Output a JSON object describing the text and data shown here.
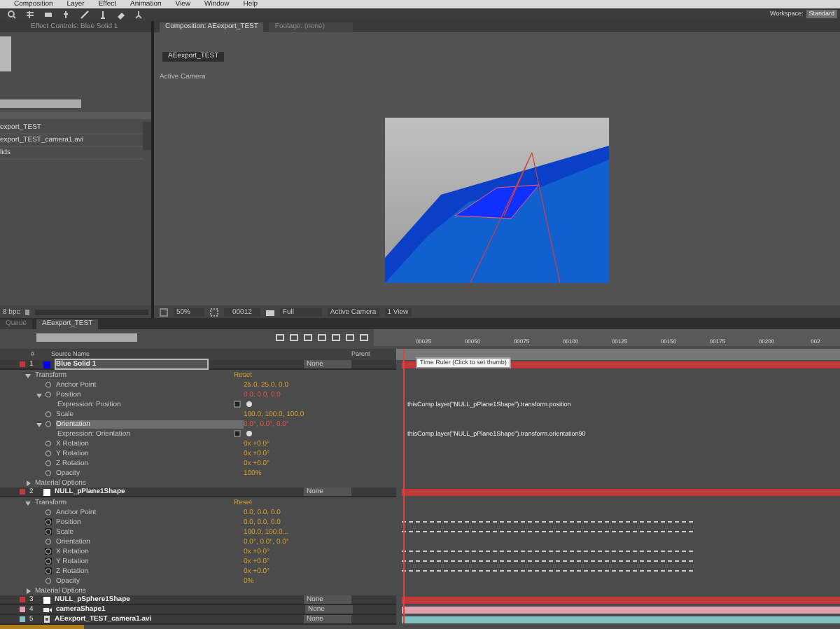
{
  "menu": [
    "Composition",
    "Layer",
    "Effect",
    "Animation",
    "View",
    "Window",
    "Help"
  ],
  "workspace": {
    "label": "Workspace:",
    "value": "Standard"
  },
  "left_panel": {
    "tab": "Effect Controls: Blue Solid 1",
    "project_items": [
      "export_TEST",
      "export_TEST_camera1.avi",
      "lids"
    ],
    "bpc": "8 bpc"
  },
  "viewer": {
    "tabs": [
      {
        "label": "Composition: AEexport_TEST",
        "selected": true
      },
      {
        "label": "Footage: (none)",
        "selected": false
      }
    ],
    "comp_tab": "AEexport_TEST",
    "camera_label": "Active Camera",
    "zoom": "50%",
    "timecode": "00012",
    "resolution": "Full",
    "view": "Active Camera",
    "layout": "1 View"
  },
  "timeline": {
    "tabs": [
      {
        "label": "Queue",
        "selected": false
      },
      {
        "label": "AEexport_TEST",
        "selected": true
      }
    ],
    "columns": [
      "#",
      "Source Name",
      "Parent"
    ],
    "ruler": [
      "00025",
      "00050",
      "00075",
      "00100",
      "00125",
      "00150",
      "00175",
      "00200",
      "002"
    ],
    "tooltip": "Time Ruler (Click to set thumb)",
    "layers": [
      {
        "number": "1",
        "name": "Blue Solid 1",
        "kind": "solid",
        "swatch": {
          "color": "#0000ff"
        },
        "color": "#c03a3a",
        "selected": true,
        "parent": "None",
        "children": [
          {
            "name": "Transform",
            "value": "Reset",
            "expanded": true,
            "children": [
              {
                "name": "Anchor Point",
                "value": "25.0, 25.0, 0.0"
              },
              {
                "name": "Position",
                "value": "0.0, 0.0, 0.0",
                "expression": true,
                "expanded": true,
                "children": [
                  {
                    "name": "Expression: Position",
                    "expression_text": "thisComp.layer(\"NULL_pPlane1Shape\").transform.position"
                  }
                ]
              },
              {
                "name": "Scale",
                "value": "100.0, 100.0, 100.0"
              },
              {
                "name": "Orientation",
                "value": "0.0°, 0.0°, 0.0°",
                "expression": true,
                "selected": true,
                "expanded": true,
                "children": [
                  {
                    "name": "Expression: Orientation",
                    "expression_text": "thisComp.layer(\"NULL_pPlane1Shape\").transform.orientation90"
                  }
                ]
              },
              {
                "name": "X Rotation",
                "value": "0x +0.0°"
              },
              {
                "name": "Y Rotation",
                "value": "0x +0.0°"
              },
              {
                "name": "Z Rotation",
                "value": "0x +0.0°"
              },
              {
                "name": "Opacity",
                "value": "100%"
              }
            ]
          },
          {
            "name": "Material Options",
            "expanded": false
          }
        ]
      },
      {
        "number": "2",
        "name": "NULL_pPlane1Shape",
        "kind": "solid",
        "swatch": {
          "color": "#ffffff"
        },
        "color": "#c03a3a",
        "selected": false,
        "parent": "None",
        "children": [
          {
            "name": "Transform",
            "value": "Reset",
            "expanded": true,
            "children": [
              {
                "name": "Anchor Point",
                "value": "0.0, 0.0, 0.0"
              },
              {
                "name": "Position",
                "value": "0.0, 0.0, 0.0",
                "animated": true
              },
              {
                "name": "Scale",
                "value": "100.0, 100.0...",
                "animated": true
              },
              {
                "name": "Orientation",
                "value": "0.0°, 0.0°, 0.0°"
              },
              {
                "name": "X Rotation",
                "value": "0x +0.0°",
                "animated": true
              },
              {
                "name": "Y Rotation",
                "value": "0x +0.0°",
                "animated": true
              },
              {
                "name": "Z Rotation",
                "value": "0x +0.0°",
                "animated": true
              },
              {
                "name": "Opacity",
                "value": "0%"
              }
            ]
          },
          {
            "name": "Material Options",
            "expanded": false
          }
        ]
      },
      {
        "number": "3",
        "name": "NULL_pSphere1Shape",
        "kind": "solid",
        "swatch": {
          "color": "#ffffff"
        },
        "color": "#c03a3a",
        "selected": false,
        "parent": "None"
      },
      {
        "number": "4",
        "name": "cameraShape1",
        "kind": "camera",
        "color": "#e0a0b0",
        "selected": false,
        "parent": "None"
      },
      {
        "number": "5",
        "name": "AEexport_TEST_camera1.avi",
        "kind": "footage",
        "color": "#80c0c0",
        "selected": false,
        "parent": "None"
      }
    ]
  }
}
